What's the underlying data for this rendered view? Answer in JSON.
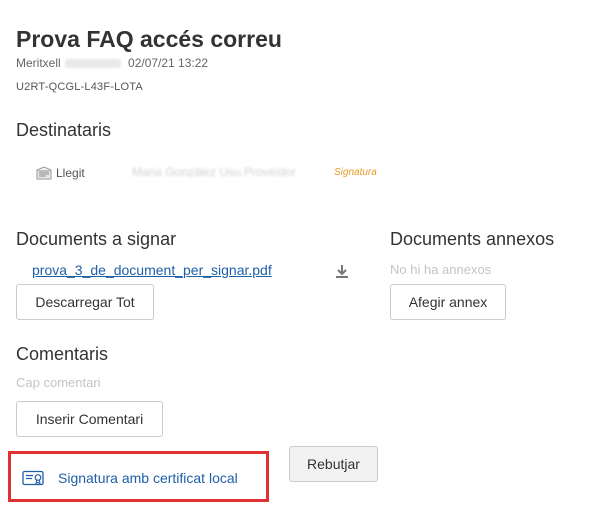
{
  "header": {
    "title": "Prova FAQ accés correu",
    "author": "Meritxell",
    "date": "02/07/21 13:22",
    "code": "U2RT-QCGL-L43F-LOTA"
  },
  "recipients": {
    "heading": "Destinataris",
    "status": "Llegit",
    "name": "Maria González Usu.Proveïdor",
    "tag": "Signatura"
  },
  "documents": {
    "heading": "Documents a signar",
    "file_name": "prova_3_de_document_per_signar.pdf",
    "download_all_label": "Descarregar Tot"
  },
  "annexes": {
    "heading": "Documents annexos",
    "empty_text": "No hi ha annexos",
    "add_label": "Afegir annex"
  },
  "comments": {
    "heading": "Comentaris",
    "empty_text": "Cap comentari",
    "insert_label": "Inserir Comentari"
  },
  "actions": {
    "local_sign_label": "Signatura amb certificat local",
    "reject_label": "Rebutjar",
    "highlight_color": "#e03131",
    "link_color": "#1f5fa8"
  }
}
